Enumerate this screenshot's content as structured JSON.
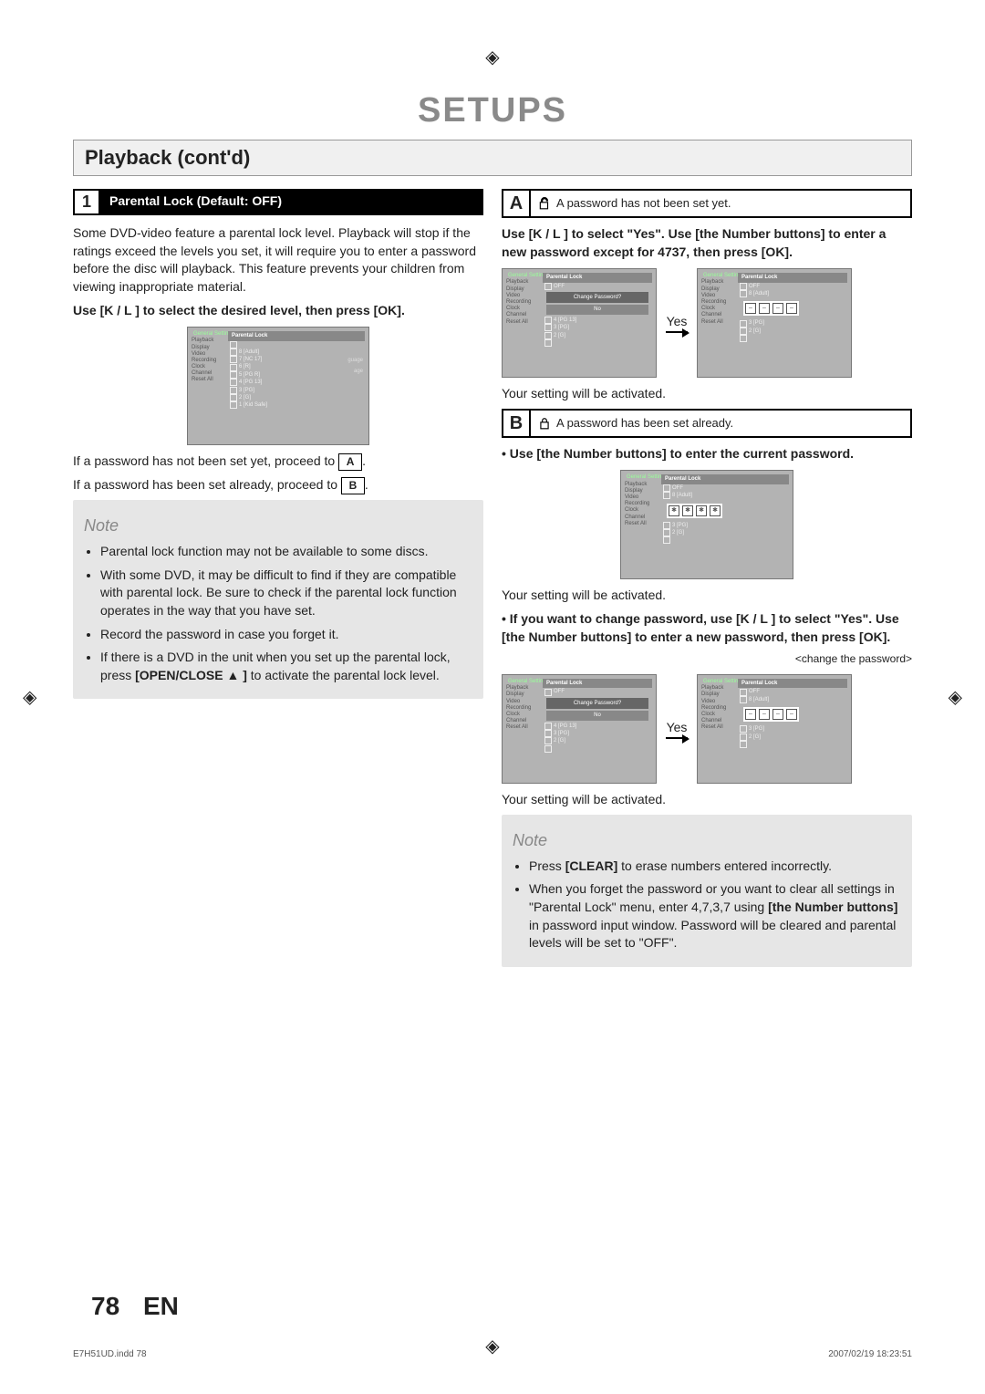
{
  "page_title": "SETUPS",
  "section_title": "Playback (cont'd)",
  "step1": {
    "num": "1",
    "label": "Parental Lock (Default: OFF)"
  },
  "intro_para": "Some DVD-video feature a parental lock level. Playback will stop if the ratings exceed the levels you set, it will require you to enter a password before the disc will playback. This feature prevents your children from viewing inappropriate material.",
  "instr_left": "Use [K / L ] to select the desired level, then press [OK].",
  "if_not_set_1": "If a password has not been set yet, proceed to ",
  "if_not_set_box": "A",
  "if_set_1": "If a password has been set already, proceed to ",
  "if_set_box": "B",
  "note_title": "Note",
  "notes_left": [
    "Parental lock function may not be available to some discs.",
    "With some DVD, it may be difficult to find if they are compatible with parental lock. Be sure to check if the parental lock function operates in the way that you have set.",
    "Record the password in case you forget it.",
    "If there is a DVD in the unit when you set up the parental lock, press [OPEN/CLOSE ▲ ] to activate the parental lock level."
  ],
  "callout_a": {
    "letter": "A",
    "text": "A password has not been set yet."
  },
  "instr_a": "Use [K / L ] to select \"Yes\". Use [the Number buttons] to enter a new password except for 4737, then press [OK].",
  "yes_label": "Yes",
  "activated": "Your setting will be activated.",
  "callout_b": {
    "letter": "B",
    "text": "A password has been set already."
  },
  "instr_b1": "• Use [the Number buttons] to enter the current password.",
  "instr_b2": "• If you want to change password, use [K / L ] to select \"Yes\". Use [the Number buttons] to enter a new password, then press [OK].",
  "change_pw_caption": "<change the password>",
  "notes_right": [
    "Press [CLEAR] to erase numbers entered incorrectly.",
    "When you forget the password or you want to clear all settings in \"Parental Lock\" menu, enter 4,7,3,7 using [the Number buttons] in password input window. Password will be cleared and parental levels will be set to \"OFF\"."
  ],
  "gui": {
    "title": "General Setting",
    "sidebar": [
      "Playback",
      "Display",
      "Video",
      "Recording",
      "Clock",
      "Channel",
      "Reset All"
    ],
    "header": "Parental Lock",
    "off": "OFF",
    "levels": [
      "8 [Adult]",
      "7 [NC 17]",
      "6 [R]",
      "5 [PG R]",
      "4 [PG 13]",
      "3 [PG]",
      "2 [G]",
      "1 [Kid Safe]"
    ],
    "change_q": "Change Password?",
    "no": "No",
    "hint1": "guage",
    "hint2": "age"
  },
  "footer": {
    "page": "78",
    "lang": "EN"
  },
  "footnote": {
    "left": "E7H51UD.indd   78",
    "right": "2007/02/19   18:23:51"
  }
}
